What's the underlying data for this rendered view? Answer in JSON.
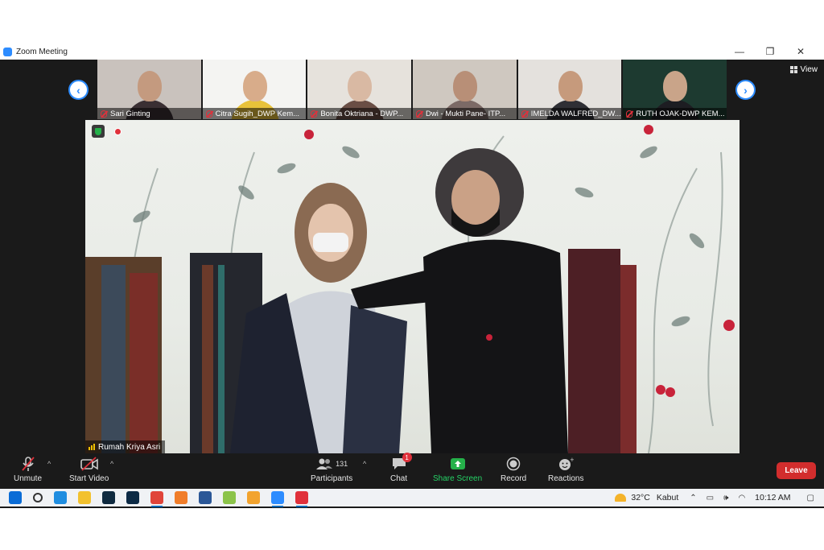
{
  "window": {
    "title": "Zoom Meeting",
    "controls": [
      "—",
      "❐",
      "✕"
    ]
  },
  "gallery": {
    "participants": [
      {
        "name": "Sari Ginting",
        "bg": "#c9c2bd",
        "face": "#c49a7f",
        "body": "#3a2f33"
      },
      {
        "name": "Citra Sugih_DWP Kem...",
        "bg": "#f4f4f2",
        "face": "#d8ac8a",
        "body": "#e8c23a"
      },
      {
        "name": "Bonita Oktriana - DWP...",
        "bg": "#e6e2dc",
        "face": "#d9b9a3",
        "body": "#6a4e45"
      },
      {
        "name": "Dwi - Mukti Pane- ITP...",
        "bg": "#cfc8c0",
        "face": "#b88f77",
        "body": "#7c6a66"
      },
      {
        "name": "IMELDA WALFRED_DW...",
        "bg": "#e4e1dd",
        "face": "#c69a7c",
        "body": "#2f2f35"
      },
      {
        "name": "RUTH OJAK-DWP KEM...",
        "bg": "#1d3a30",
        "face": "#c9a489",
        "body": "#1d1d22"
      }
    ],
    "prev_icon": "‹",
    "next_icon": "›",
    "view_label": "View"
  },
  "main_video": {
    "speaker_name": "Rumah Kriya Asri"
  },
  "toolbar": {
    "unmute_label": "Unmute",
    "start_video_label": "Start Video",
    "participants_label": "Participants",
    "participants_count": "131",
    "chat_label": "Chat",
    "chat_badge": "1",
    "share_label": "Share Screen",
    "record_label": "Record",
    "reactions_label": "Reactions",
    "leave_label": "Leave"
  },
  "taskbar": {
    "icons": [
      {
        "name": "windows-start-icon",
        "color": "#0a6cd6"
      },
      {
        "name": "search-icon",
        "color": "#333333"
      },
      {
        "name": "edge-icon",
        "color": "#1f8de0"
      },
      {
        "name": "file-explorer-icon",
        "color": "#f2c12e"
      },
      {
        "name": "lightroom-icon",
        "color": "#0f2a3f"
      },
      {
        "name": "photoshop-icon",
        "color": "#0c2a45"
      },
      {
        "name": "chrome-icon",
        "color": "#e0443a"
      },
      {
        "name": "firefox-icon",
        "color": "#f07d2a"
      },
      {
        "name": "word-icon",
        "color": "#2b5797"
      },
      {
        "name": "app-icon",
        "color": "#8bc34a"
      },
      {
        "name": "store-icon",
        "color": "#f2a32e"
      },
      {
        "name": "zoom-icon",
        "color": "#2d8cff"
      },
      {
        "name": "record-app-icon",
        "color": "#e0313b"
      }
    ],
    "temperature": "32°C",
    "weather": "Kabut",
    "time": "10:12 AM"
  }
}
